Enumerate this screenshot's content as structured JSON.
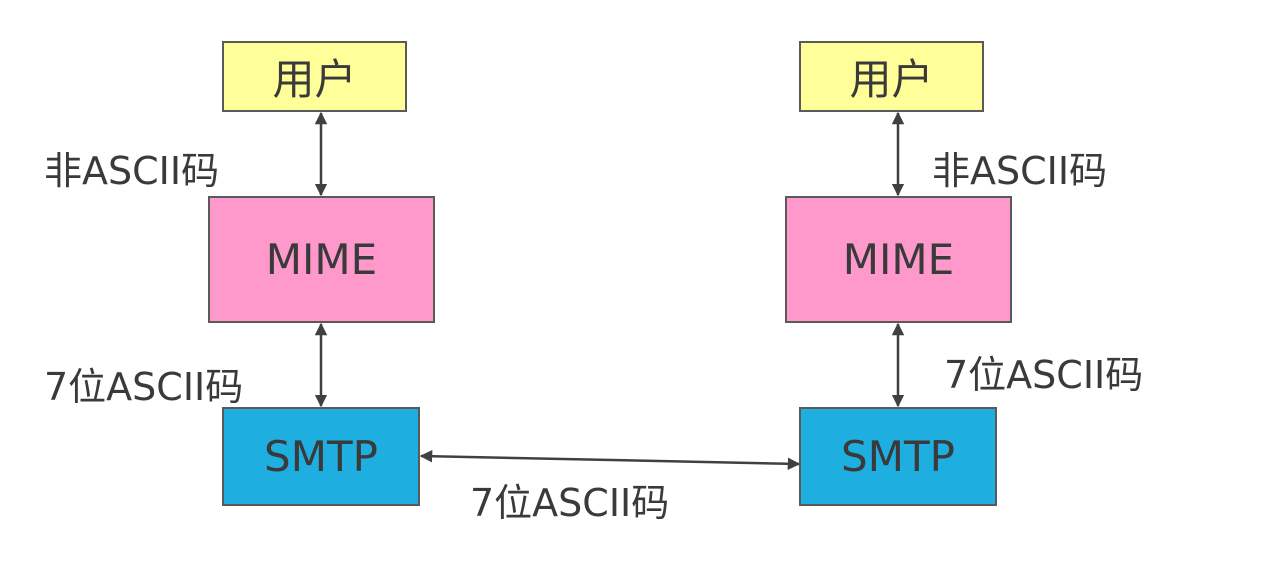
{
  "left": {
    "user": "用户",
    "mime": "MIME",
    "smtp": "SMTP",
    "upper_label": "非ASCII码",
    "lower_label": "7位ASCII码"
  },
  "right": {
    "user": "用户",
    "mime": "MIME",
    "smtp": "SMTP",
    "upper_label": "非ASCII码",
    "lower_label": "7位ASCII码"
  },
  "link_label": "7位ASCII码",
  "colors": {
    "user_fill": "#ffff99",
    "mime_fill": "#ff99cc",
    "smtp_fill": "#1eaedf",
    "border": "#5a5a5a",
    "arrow": "#404040"
  }
}
